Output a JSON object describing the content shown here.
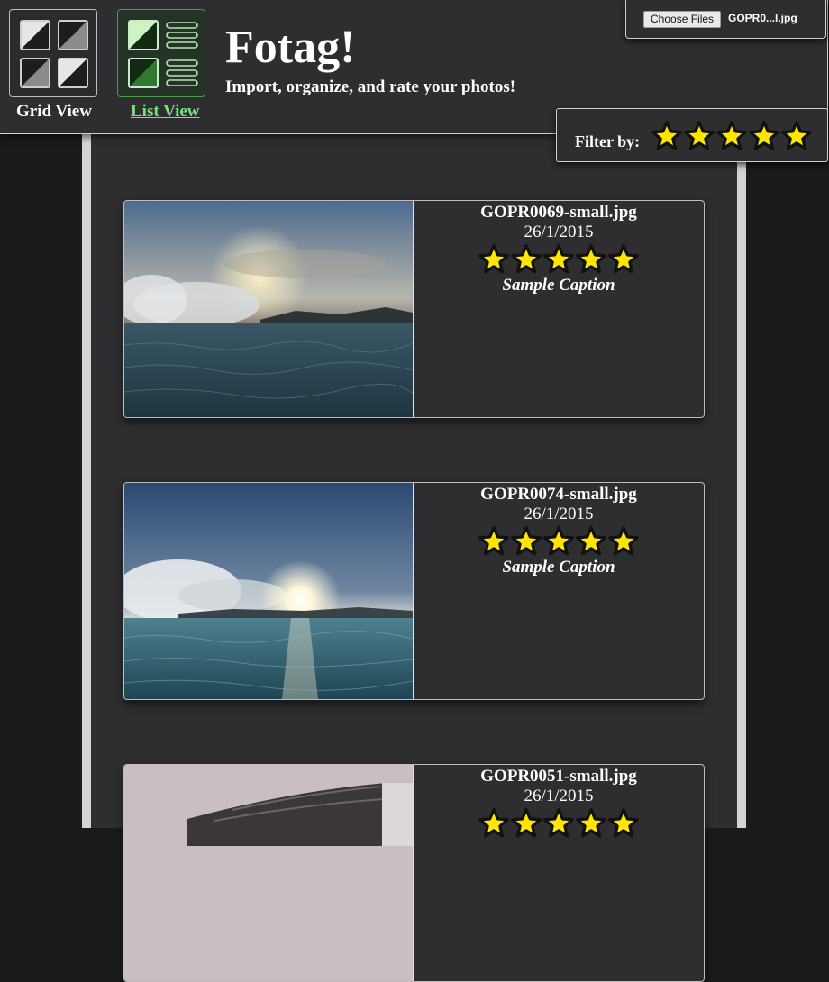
{
  "app": {
    "title": "Fotag!",
    "subtitle": "Import, organize, and rate your photos!"
  },
  "views": {
    "grid_label": "Grid View",
    "list_label": "List View",
    "active": "list"
  },
  "file_input": {
    "button_label": "Choose Files",
    "selected_file": "GOPR0...l.jpg"
  },
  "filter": {
    "label": "Filter by:",
    "stars": 5
  },
  "colors": {
    "star_fill": "#ffe600",
    "star_stroke": "#111111",
    "active_view": "#79e07a",
    "background": "#2e2e30"
  },
  "photos": [
    {
      "filename": "GOPR0069-small.jpg",
      "date": "26/1/2015",
      "rating": 5,
      "caption": "Sample Caption"
    },
    {
      "filename": "GOPR0074-small.jpg",
      "date": "26/1/2015",
      "rating": 5,
      "caption": "Sample Caption"
    },
    {
      "filename": "GOPR0051-small.jpg",
      "date": "26/1/2015",
      "rating": 5,
      "caption": ""
    }
  ]
}
